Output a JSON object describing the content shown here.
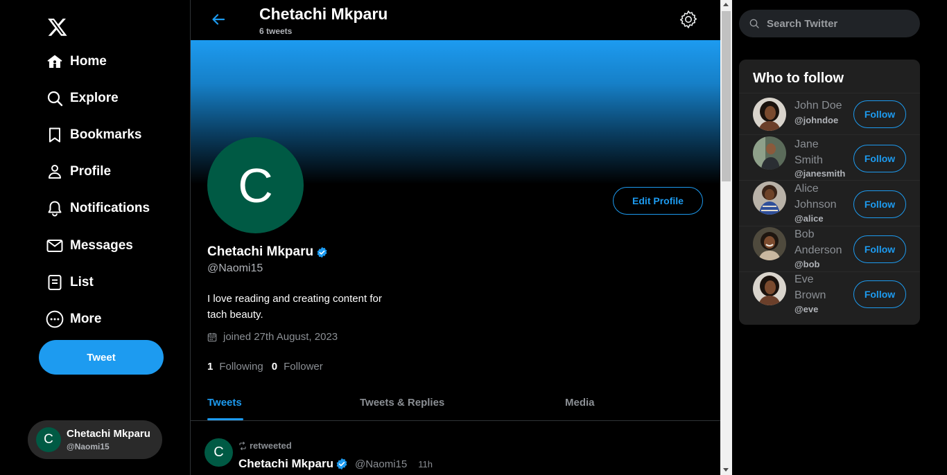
{
  "sidebar": {
    "logo": "x-logo-icon",
    "nav": [
      {
        "label": "Home",
        "icon": "home-icon"
      },
      {
        "label": "Explore",
        "icon": "search-icon"
      },
      {
        "label": "Bookmarks",
        "icon": "bookmark-icon"
      },
      {
        "label": "Profile",
        "icon": "person-icon"
      },
      {
        "label": "Notifications",
        "icon": "bell-icon"
      },
      {
        "label": "Messages",
        "icon": "mail-icon"
      },
      {
        "label": "List",
        "icon": "list-icon"
      },
      {
        "label": "More",
        "icon": "more-icon"
      }
    ],
    "tweet_label": "Tweet",
    "account": {
      "initial": "C",
      "name": "Chetachi Mkparu",
      "handle": "@Naomi15"
    }
  },
  "header": {
    "title": "Chetachi Mkparu",
    "count": "6 tweets"
  },
  "profile": {
    "initial": "C",
    "edit_label": "Edit Profile",
    "name": "Chetachi Mkparu",
    "handle": "@Naomi15",
    "bio_line1": "I love reading and creating content for",
    "bio_line2": "tach beauty.",
    "joined": "joined 27th August, 2023",
    "following_count": "1",
    "following_label": "Following",
    "follower_count": "0",
    "follower_label": "Follower"
  },
  "tabs": [
    {
      "label": "Tweets",
      "active": true
    },
    {
      "label": "Tweets & Replies",
      "active": false
    },
    {
      "label": "Media",
      "active": false
    }
  ],
  "tweet": {
    "initial": "C",
    "retweet_label": "retweeted",
    "name": "Chetachi Mkparu",
    "handle": "@Naomi15",
    "time": "11h"
  },
  "search": {
    "placeholder": "Search Twitter"
  },
  "who_to_follow": {
    "title": "Who to follow",
    "follow_label": "Follow",
    "users": [
      {
        "name_line1": "John Doe",
        "name_line2": "",
        "handle": "@johndoe"
      },
      {
        "name_line1": "Jane",
        "name_line2": "Smith",
        "handle": "@janesmith"
      },
      {
        "name_line1": "Alice",
        "name_line2": "Johnson",
        "handle": "@alice"
      },
      {
        "name_line1": "Bob",
        "name_line2": "Anderson",
        "handle": "@bob"
      },
      {
        "name_line1": "Eve",
        "name_line2": "Brown",
        "handle": "@eve"
      }
    ]
  },
  "colors": {
    "accent": "#1d9bf0",
    "avatar_bg": "#005a44",
    "card_bg": "#202020"
  }
}
